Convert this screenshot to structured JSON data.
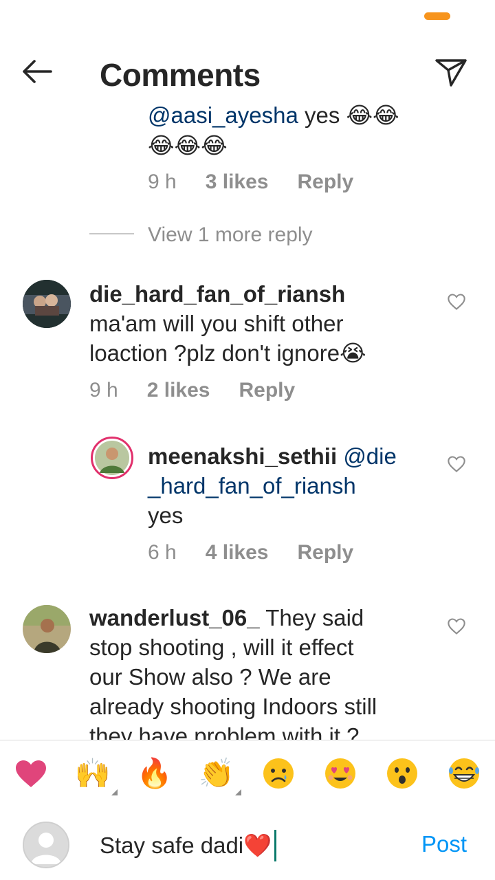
{
  "header": {
    "title": "Comments"
  },
  "thread_top": {
    "mention": "@aasi_ayesha",
    "text": " yes 😂😂",
    "text_line2": "😂😂😂",
    "time": "9 h",
    "likes": "3 likes",
    "reply": "Reply",
    "view_more": "View 1 more reply"
  },
  "comments": [
    {
      "username": "die_hard_fan_of_riansh",
      "line1": "ma'am will you shift other",
      "line2": "loaction ?plz don't ignore😭",
      "time": "9 h",
      "likes": "2 likes",
      "reply": "Reply"
    },
    {
      "username": "meenakshi_sethii",
      "mention1": "@die",
      "mention2": "_hard_fan_of_riansh",
      "line3": "yes",
      "time": "6 h",
      "likes": "4 likes",
      "reply": "Reply"
    },
    {
      "username": "wanderlust_06_",
      "line1": " They said",
      "line2": "stop shooting , will it effect",
      "line3": "our Show also ? We are",
      "line4": "already shooting Indoors still",
      "line5": "they have problem with it ?"
    }
  ],
  "emoji_bar": [
    {
      "icon": "heart-icon",
      "glyph": "❤️"
    },
    {
      "icon": "raised-hands-icon",
      "glyph": "🙌"
    },
    {
      "icon": "fire-icon",
      "glyph": "🔥"
    },
    {
      "icon": "clapping-hands-icon",
      "glyph": "👏"
    },
    {
      "icon": "sad-face-icon",
      "glyph": "😢"
    },
    {
      "icon": "heart-eyes-icon",
      "glyph": "😍"
    },
    {
      "icon": "surprised-face-icon",
      "glyph": "😮"
    },
    {
      "icon": "laughing-face-icon",
      "glyph": "😂"
    }
  ],
  "composer": {
    "input_value": "Stay safe dadi❤️",
    "post_label": "Post"
  },
  "colors": {
    "accent": "#0095f6",
    "mention": "#003569",
    "muted": "#8e8e8e",
    "status_pill": "#f7941d"
  }
}
